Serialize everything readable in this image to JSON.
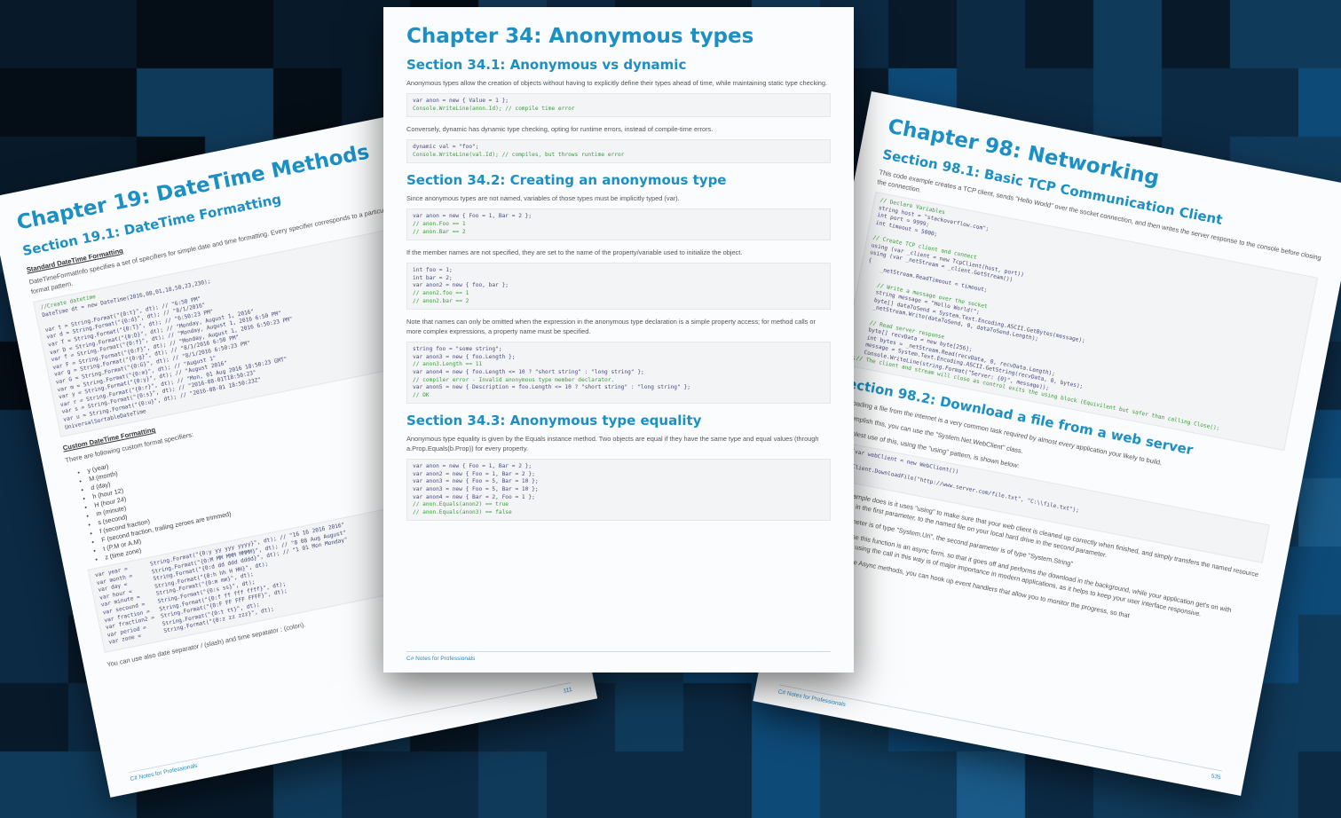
{
  "background": {
    "base_color": "#0a2236",
    "tile_colors": [
      "#050d16",
      "#081a2a",
      "#0c2a44",
      "#103a5a",
      "#0e4a78",
      "#1a5a88"
    ]
  },
  "pages": {
    "left": {
      "chapter_title": "Chapter 19: DateTime Methods",
      "section1_title": "Section 19.1: DateTime Formatting",
      "standard_heading": "Standard DateTime Formatting",
      "standard_text": "DateTimeFormatInfo specifies a set of specifiers for simple date and time formatting. Every specifier corresponds to a particular DateTimeFormatInfo format pattern.",
      "code1": [
        {
          "t": "//Create datetime",
          "c": "cm"
        },
        {
          "t": "DateTime dt = new DateTime(2016,08,01,18,50,23,230);",
          "c": ""
        },
        {
          "t": "",
          "c": ""
        },
        {
          "t": "var t = String.Format(\"{0:t}\", dt); // \"6:50 PM\"",
          "c": ""
        },
        {
          "t": "var d = String.Format(\"{0:d}\", dt); // \"8/1/2016\"",
          "c": ""
        },
        {
          "t": "var T = String.Format(\"{0:T}\", dt); // \"6:50:23 PM\"",
          "c": ""
        },
        {
          "t": "var D = String.Format(\"{0:D}\", dt); // \"Monday, August 1, 2016\"",
          "c": ""
        },
        {
          "t": "var f = String.Format(\"{0:f}\", dt); // \"Monday, August 1, 2016 6:50 PM\"",
          "c": ""
        },
        {
          "t": "var F = String.Format(\"{0:F}\", dt); // \"Monday, August 1, 2016 6:50:23 PM\"",
          "c": ""
        },
        {
          "t": "var g = String.Format(\"{0:g}\", dt); // \"8/1/2016 6:50 PM\"",
          "c": ""
        },
        {
          "t": "var G = String.Format(\"{0:G}\", dt); // \"8/1/2016 6:50:23 PM\"",
          "c": ""
        },
        {
          "t": "var m = String.Format(\"{0:m}\", dt); // \"August 1\"",
          "c": ""
        },
        {
          "t": "var y = String.Format(\"{0:y}\", dt); // \"August 2016\"",
          "c": ""
        },
        {
          "t": "var r = String.Format(\"{0:r}\", dt); // \"Mon, 01 Aug 2016 18:50:23 GMT\"",
          "c": ""
        },
        {
          "t": "var s = String.Format(\"{0:s}\", dt); // \"2016-08-01T18:50:23\"",
          "c": ""
        },
        {
          "t": "var u = String.Format(\"{0:u}\", dt); // \"2016-08-01 18:50:23Z\"",
          "c": ""
        },
        {
          "t": "UniversalSortableDateTime",
          "c": ""
        }
      ],
      "custom_heading": "Custom DateTime Formatting",
      "custom_text": "There are following custom format specifiers:",
      "bullets": [
        "y (year)",
        "M (month)",
        "d (day)",
        "h (hour 12)",
        "H (hour 24)",
        "m (minute)",
        "s (second)",
        "f (second fraction)",
        "F (second fraction, trailing zeroes are trimmed)",
        "t (P.M or A.M)",
        "z (time zone)"
      ],
      "code2": [
        {
          "t": "var year =       String.Format(\"{0:y yy yyy yyyy}\", dt); // \"16 16 2016 2016\"",
          "c": ""
        },
        {
          "t": "var month =      String.Format(\"{0:M MM MMM MMMM}\", dt); // \"8 08 Aug August\"",
          "c": ""
        },
        {
          "t": "var day =        String.Format(\"{0:d dd ddd dddd}\", dt); // \"1 01 Mon Monday\"",
          "c": ""
        },
        {
          "t": "var hour =       String.Format(\"{0:h hh H HH}\", dt);",
          "c": ""
        },
        {
          "t": "var minute =     String.Format(\"{0:m mm}\", dt);",
          "c": ""
        },
        {
          "t": "var secound =    String.Format(\"{0:s ss}\", dt);",
          "c": ""
        },
        {
          "t": "var fraction =   String.Format(\"{0:f ff fff ffff}\", dt);",
          "c": ""
        },
        {
          "t": "var fraction2 =  String.Format(\"{0:F FF FFF FFFF}\", dt);",
          "c": ""
        },
        {
          "t": "var period =     String.Format(\"{0:t tt}\", dt);",
          "c": ""
        },
        {
          "t": "var zone =       String.Format(\"{0:z zz zzz}\", dt);",
          "c": ""
        }
      ],
      "bottom_text": "You can use also date separator / (slash) and time sepatator : (colon).",
      "footer_left": "C# Notes for Professionals",
      "footer_num": "111"
    },
    "middle": {
      "chapter_title": "Chapter 34: Anonymous types",
      "section1_title": "Section 34.1: Anonymous vs dynamic",
      "p1": "Anonymous types allow the creation of objects without having to explicitly define their types ahead of time, while maintaining static type checking.",
      "code1": [
        {
          "t": "var anon = new { Value = 1 };",
          "c": ""
        },
        {
          "t": "Console.WriteLine(anon.Id); // compile time error",
          "c": "cm"
        }
      ],
      "p2": "Conversely, dynamic has dynamic type checking, opting for runtime errors, instead of compile-time errors.",
      "code2": [
        {
          "t": "dynamic val = \"foo\";",
          "c": ""
        },
        {
          "t": "Console.WriteLine(val.Id); // compiles, but throws runtime error",
          "c": "cm"
        }
      ],
      "section2_title": "Section 34.2: Creating an anonymous type",
      "p3": "Since anonymous types are not named, variables of those types must be implicitly typed (var).",
      "code3": [
        {
          "t": "var anon = new { Foo = 1, Bar = 2 };",
          "c": ""
        },
        {
          "t": "// anon.Foo == 1",
          "c": "cm"
        },
        {
          "t": "// anon.Bar == 2",
          "c": "cm"
        }
      ],
      "p4": "If the member names are not specified, they are set to the name of the property/variable used to initialize the object.",
      "code4": [
        {
          "t": "int foo = 1;",
          "c": ""
        },
        {
          "t": "int bar = 2;",
          "c": ""
        },
        {
          "t": "var anon2 = new { foo, bar };",
          "c": ""
        },
        {
          "t": "// anon2.foo == 1",
          "c": "cm"
        },
        {
          "t": "// anon2.bar == 2",
          "c": "cm"
        }
      ],
      "p5": "Note that names can only be omitted when the expression in the anonymous type declaration is a simple property access; for method calls or more complex expressions, a property name must be specified.",
      "code5": [
        {
          "t": "string foo = \"some string\";",
          "c": ""
        },
        {
          "t": "var anon3 = new { foo.Length };",
          "c": ""
        },
        {
          "t": "// anon3.Length == 11",
          "c": "cm"
        },
        {
          "t": "var anon4 = new { foo.Length <= 10 ? \"short string\" : \"long string\" };",
          "c": ""
        },
        {
          "t": "// compiler error - Invalid anonymous type member declarator.",
          "c": "cm"
        },
        {
          "t": "var anon5 = new { Description = foo.Length <= 10 ? \"short string\" : \"long string\" };",
          "c": ""
        },
        {
          "t": "// OK",
          "c": "cm"
        }
      ],
      "section3_title": "Section 34.3: Anonymous type equality",
      "p6": "Anonymous type equality is given by the Equals instance method. Two objects are equal if they have the same type and equal values (through a.Prop.Equals(b.Prop)) for every property.",
      "code6": [
        {
          "t": "var anon = new { Foo = 1, Bar = 2 };",
          "c": ""
        },
        {
          "t": "var anon2 = new { Foo = 1, Bar = 2 };",
          "c": ""
        },
        {
          "t": "var anon3 = new { Foo = 5, Bar = 10 };",
          "c": ""
        },
        {
          "t": "var anon3 = new { Foo = 5, Bar = 10 };",
          "c": ""
        },
        {
          "t": "var anon4 = new { Bar = 2, Foo = 1 };",
          "c": ""
        },
        {
          "t": "// anon.Equals(anon2) == true",
          "c": "cm"
        },
        {
          "t": "// anon.Equals(anon3) == false",
          "c": "cm"
        }
      ],
      "footer_left": "C# Notes for Professionals"
    },
    "right": {
      "chapter_title": "Chapter 98: Networking",
      "section1_title": "Section 98.1: Basic TCP Communication Client",
      "p1": "This code example creates a TCP client, sends \"Hello World\" over the socket connection, and then writes the server response to the console before closing the connection.",
      "code1": [
        {
          "t": "// Declare Variables",
          "c": "cm"
        },
        {
          "t": "string host = \"stackoverflow.com\";",
          "c": ""
        },
        {
          "t": "int port = 9999;",
          "c": ""
        },
        {
          "t": "int timeout = 5000;",
          "c": ""
        },
        {
          "t": "",
          "c": ""
        },
        {
          "t": "// Create TCP client and connect",
          "c": "cm"
        },
        {
          "t": "using (var _client = new TcpClient(host, port))",
          "c": ""
        },
        {
          "t": "using (var _netStream = _client.GetStream())",
          "c": ""
        },
        {
          "t": "{",
          "c": ""
        },
        {
          "t": "    _netStream.ReadTimeout = timeout;",
          "c": ""
        },
        {
          "t": "",
          "c": ""
        },
        {
          "t": "    // Write a message over the socket",
          "c": "cm"
        },
        {
          "t": "    string message = \"Hello World!\";",
          "c": ""
        },
        {
          "t": "    byte[] dataToSend = System.Text.Encoding.ASCII.GetBytes(message);",
          "c": ""
        },
        {
          "t": "    _netStream.Write(dataToSend, 0, dataToSend.Length);",
          "c": ""
        },
        {
          "t": "",
          "c": ""
        },
        {
          "t": "    // Read server response",
          "c": "cm"
        },
        {
          "t": "    byte[] recvData = new byte[256];",
          "c": ""
        },
        {
          "t": "    int bytes = _netStream.Read(recvData, 0, recvData.Length);",
          "c": ""
        },
        {
          "t": "    message = System.Text.Encoding.ASCII.GetString(recvData, 0, bytes);",
          "c": ""
        },
        {
          "t": "    Console.WriteLine(string.Format(\"Server: {0}\", message));",
          "c": ""
        },
        {
          "t": "};// The client and stream will close as control exits the using block (Equivilent but safer than calling Close();",
          "c": "cm"
        }
      ],
      "section2_title": "Section 98.2: Download a file from a web server",
      "p2": "Downloading a file from the internet is a very common task required by almost every application your likely to build.",
      "p3": "To accomplish this, you can use the \"System.Net.WebClient\" class.",
      "p4": "The simplest use of this, using the \"using\" pattern, is shown below:",
      "code2": [
        {
          "t": "using (var webClient = new WebClient())",
          "c": ""
        },
        {
          "t": "{",
          "c": ""
        },
        {
          "t": "    webClient.DownloadFile(\"http://www.server.com/file.txt\", \"C:\\\\file.txt\");",
          "c": ""
        },
        {
          "t": "}",
          "c": ""
        }
      ],
      "p5": "What this example does is it uses \"using\" to make sure that your web client is cleaned up correctly when finished, and simply transfers the named resource from the URL in the first parameter, to the named file on your local hard drive in the second parameter.",
      "p6": "The first parameter is of type \"System.Uri\", the second parameter is of type \"System.String\"",
      "p7": "You can also use this function is an async form, so that it goes off and performs the download in the background, while your application get's on with something else, using the call in this way is of major importance in modern applications, as it helps to keep your user interface responsive.",
      "p8": "When you use the Async methods, you can hook up event handlers that allow you to monitor the progress, so that",
      "footer_left": "C# Notes for Professionals",
      "footer_num": "535"
    }
  }
}
